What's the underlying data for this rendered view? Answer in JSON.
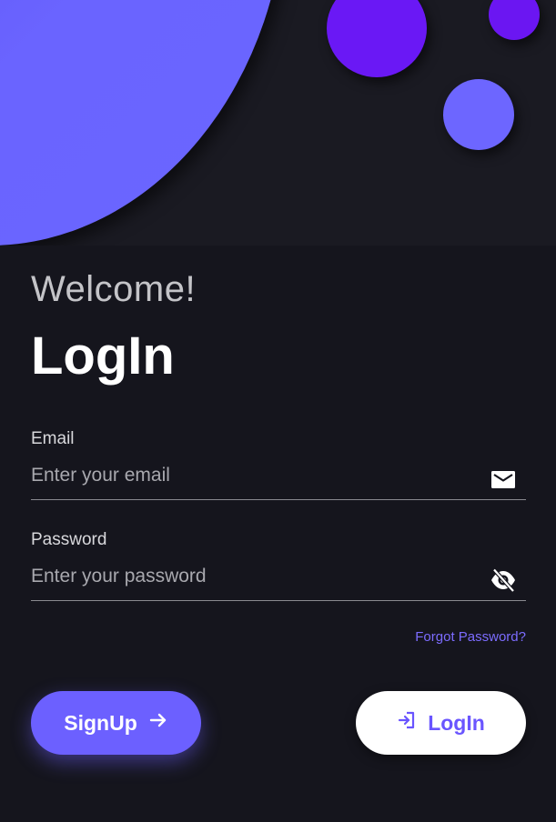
{
  "header": {
    "welcome": "Welcome!",
    "title": "LogIn"
  },
  "email": {
    "label": "Email",
    "placeholder": "Enter your email",
    "value": "",
    "icon": "mail-icon"
  },
  "password": {
    "label": "Password",
    "placeholder": "Enter your password",
    "value": "",
    "icon": "visibility-off-icon"
  },
  "links": {
    "forgot": "Forgot Password?"
  },
  "buttons": {
    "signup_label": "SignUp",
    "signup_icon": "arrow-right-icon",
    "login_label": "LogIn",
    "login_icon": "login-icon"
  },
  "colors": {
    "background": "#15151d",
    "accent": "#6c60ff",
    "accent_violet": "#6a18f5",
    "link": "#7c6cff",
    "text_primary": "#ffffff",
    "text_muted": "#c4c4c8"
  }
}
